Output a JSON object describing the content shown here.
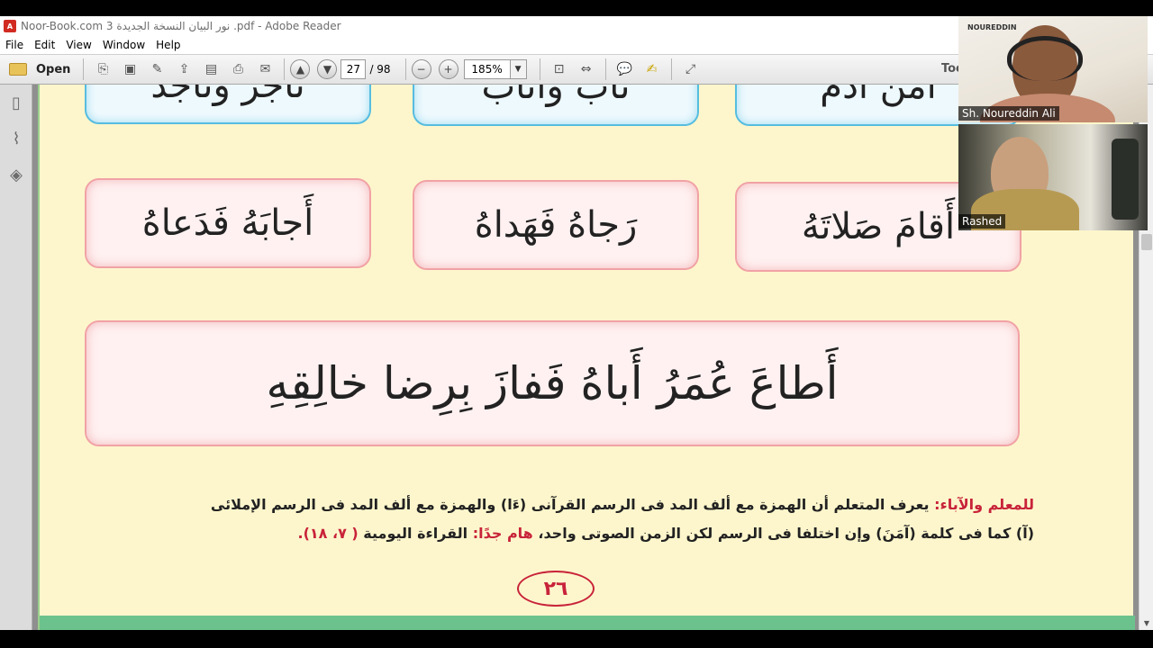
{
  "window": {
    "title": "Noor-Book.com  نور البيان النسخة الجديدة 3 .pdf - Adobe Reader"
  },
  "menu": [
    "File",
    "Edit",
    "View",
    "Window",
    "Help"
  ],
  "toolbar": {
    "open_label": "Open",
    "page_current": "27",
    "page_total": "/ 98",
    "zoom": "185%",
    "tools_label": "Too"
  },
  "document": {
    "top_row": [
      "تاجر وتاجد",
      "تاب وأتاب",
      "أمن أدم"
    ],
    "middle_row": [
      "أَجابَهُ فَدَعاهُ",
      "رَجاهُ فَهَداهُ",
      "أَقامَ صَلاتَهُ"
    ],
    "sentence": "أَطاعَ عُمَرُ أَباهُ فَفازَ بِرِضا خالِقِهِ",
    "note_label": "للمعلم والآباء:",
    "note_line1": "يعرف المتعلم أن الهمزة مع ألف المد فى الرسم القرآنى (ءَا) والهمزة مع ألف المد فى الرسم الإملائى",
    "note_line2a": "(آ) كما فى كلمة (آمَنَ) وإن اختلفا فى الرسم لكن الزمن الصوتى واحد،",
    "note_important": "هام جدًا:",
    "note_line2b": "القراءة اليومية",
    "note_pages": "( ٧، ١٨).",
    "page_number": "٢٦"
  },
  "participants": [
    {
      "name": "Sh. Noureddin Ali",
      "brand": "NOUREDDIN"
    },
    {
      "name": "Rashed"
    }
  ],
  "colors": {
    "page_bg": "#fdf6cc",
    "blue_tile": "#56bde0",
    "pink_tile": "#f1a2a6",
    "accent_red": "#c8233a"
  }
}
